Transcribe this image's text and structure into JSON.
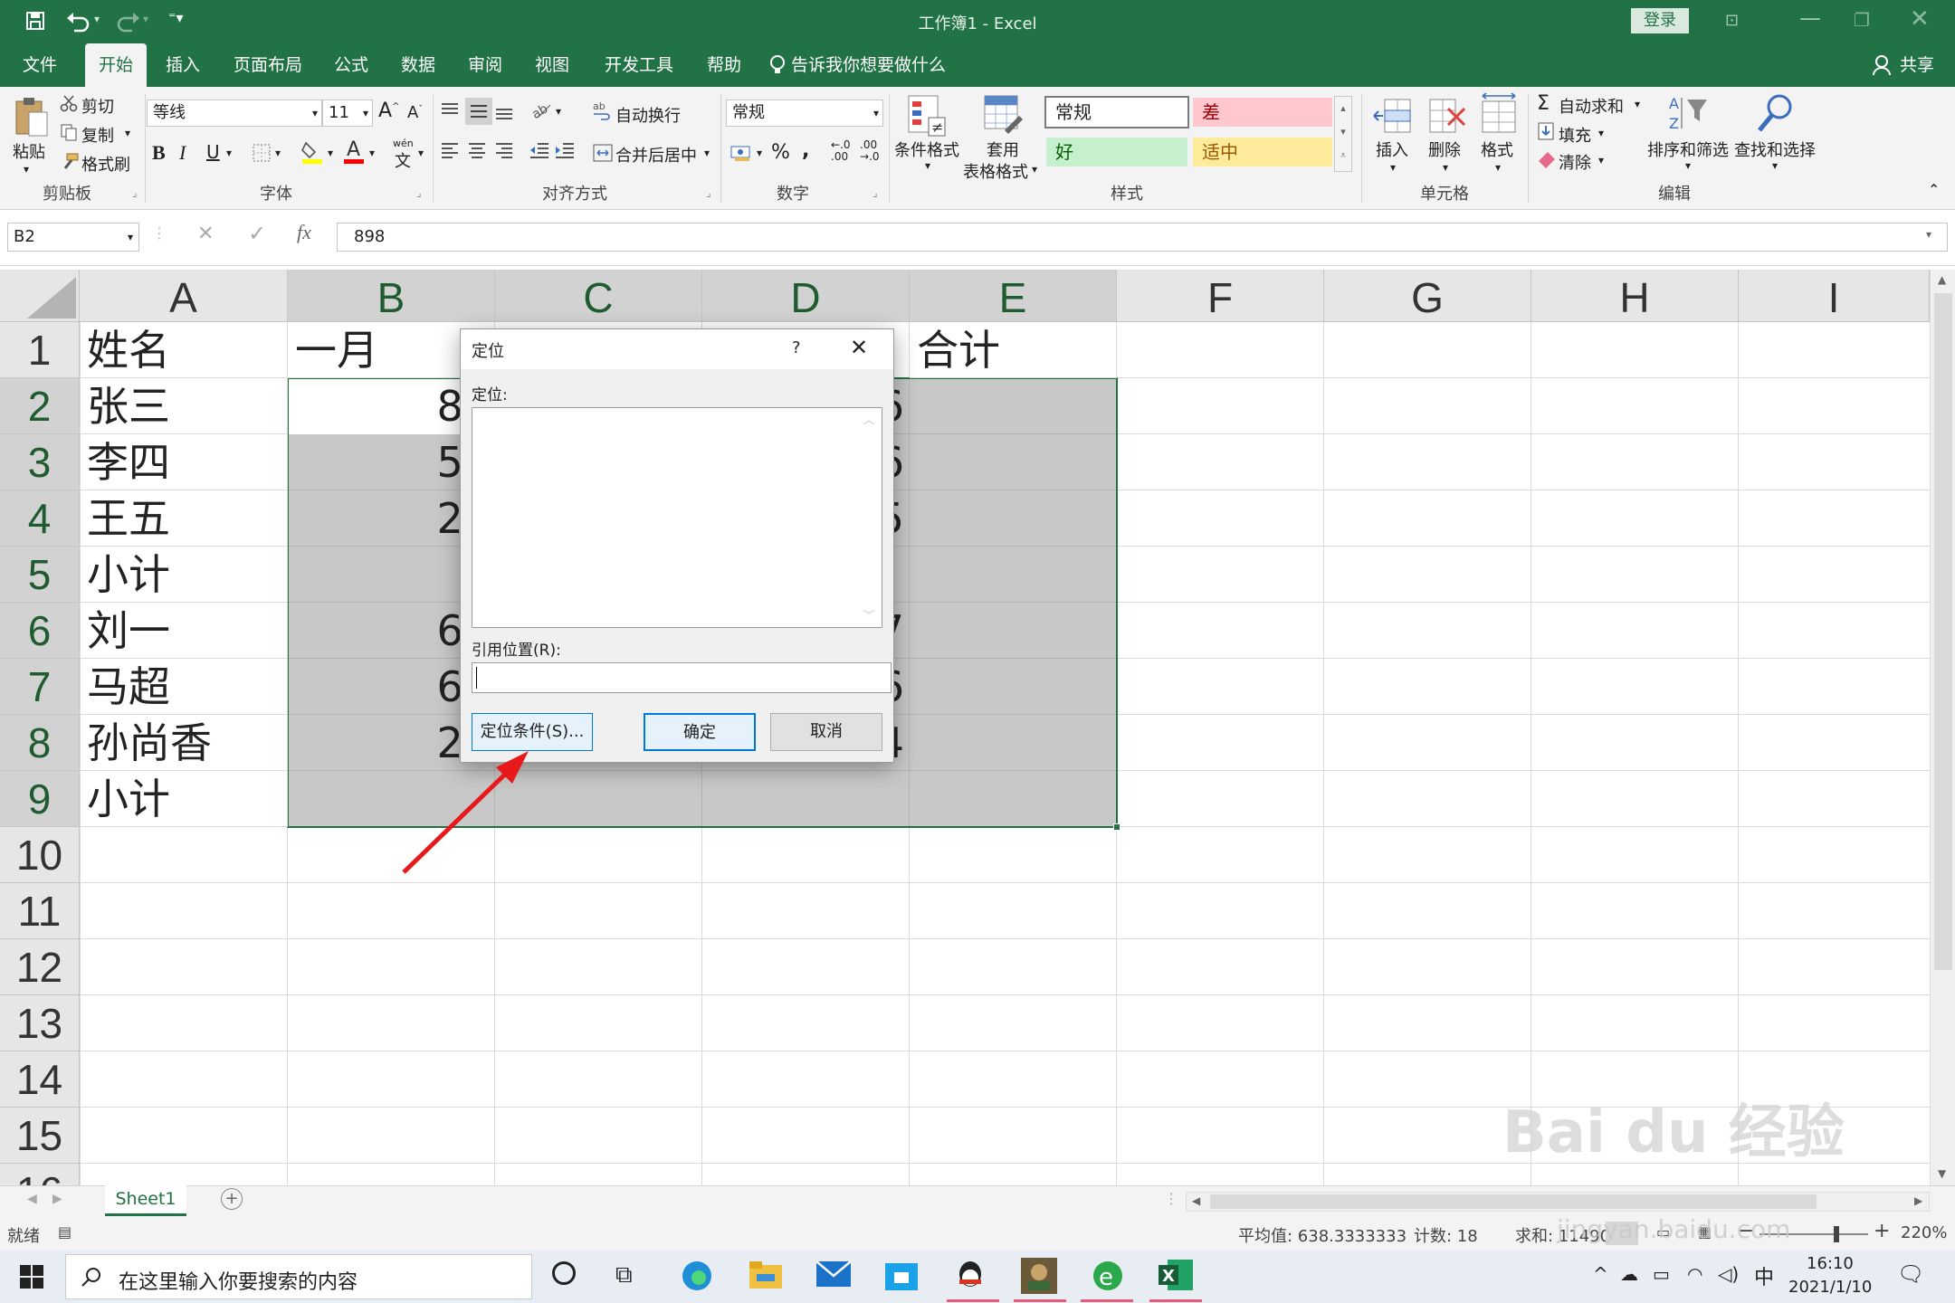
{
  "window": {
    "title": "工作簿1  -  Excel",
    "login_label": "登录"
  },
  "tabs": [
    {
      "label": "文件"
    },
    {
      "label": "开始"
    },
    {
      "label": "插入"
    },
    {
      "label": "页面布局"
    },
    {
      "label": "公式"
    },
    {
      "label": "数据"
    },
    {
      "label": "审阅"
    },
    {
      "label": "视图"
    },
    {
      "label": "开发工具"
    },
    {
      "label": "帮助"
    },
    {
      "label": "告诉我你想要做什么"
    }
  ],
  "share_label": "共享",
  "ribbon": {
    "clipboard": {
      "paste": "粘贴",
      "cut": "剪切",
      "copy": "复制",
      "format_painter": "格式刷",
      "group": "剪贴板"
    },
    "font": {
      "name": "等线",
      "size": "11",
      "bold": "B",
      "italic": "I",
      "underline": "U",
      "wen": "wén",
      "group": "字体"
    },
    "alignment": {
      "wrap": "自动换行",
      "merge": "合并后居中",
      "group": "对齐方式"
    },
    "number": {
      "format": "常规",
      "group": "数字"
    },
    "styles": {
      "conditional": "条件格式",
      "table1": "套用",
      "table2": "表格格式",
      "normal": "常规",
      "bad": "差",
      "good": "好",
      "neutral": "适中",
      "group": "样式"
    },
    "cells": {
      "insert": "插入",
      "delete": "删除",
      "format": "格式",
      "group": "单元格"
    },
    "editing": {
      "autosum": "自动求和",
      "fill": "填充",
      "clear": "清除",
      "sort": "排序和筛选",
      "find": "查找和选择",
      "group": "编辑"
    }
  },
  "formula_bar": {
    "name_box": "B2",
    "fx": "fx",
    "value": "898"
  },
  "columns": [
    "A",
    "B",
    "C",
    "D",
    "E",
    "F",
    "G",
    "H",
    "I"
  ],
  "rows": [
    "1",
    "2",
    "3",
    "4",
    "5",
    "6",
    "7",
    "8",
    "9",
    "10",
    "11",
    "12",
    "13",
    "14",
    "15",
    "16"
  ],
  "cells": {
    "A": [
      "姓名",
      "张三",
      "李四",
      "王五",
      "小计",
      "刘一",
      "马超",
      "孙尚香",
      "小计"
    ],
    "B": [
      "一月",
      "89",
      "56",
      "24",
      "",
      "65",
      "64",
      "24",
      ""
    ],
    "D_visible": [
      "",
      "6",
      "6",
      "5",
      "",
      "7",
      "6",
      "4",
      ""
    ],
    "E": [
      "合计"
    ]
  },
  "dialog": {
    "title": "定位",
    "help": "?",
    "list_label": "定位:",
    "ref_label": "引用位置(R):",
    "ref_value": "",
    "special_button": "定位条件(S)...",
    "ok_button": "确定",
    "cancel_button": "取消"
  },
  "sheets": [
    {
      "name": "Sheet1"
    }
  ],
  "status": {
    "mode": "就绪",
    "average": "平均值: 638.3333333",
    "count": "计数: 18",
    "sum": "求和: 11490",
    "zoom": "220%"
  },
  "taskbar": {
    "search_placeholder": "在这里输入你要搜索的内容",
    "ime": "中",
    "time": "16:10",
    "date": "2021/1/10"
  },
  "watermark": {
    "brand": "Bai du 经验",
    "url": "jingyan.baidu.com"
  },
  "colors": {
    "excel_green": "#217346",
    "selection": "#c8c8c8",
    "annotation_arrow": "#e8191b"
  }
}
